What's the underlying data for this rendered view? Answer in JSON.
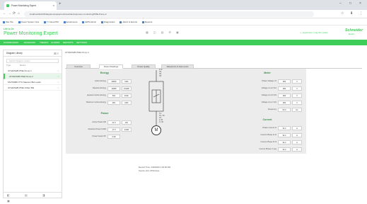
{
  "browser": {
    "tab_title": "Power Monitoring Expert",
    "tab_close": "×",
    "new_tab": "+",
    "window_controls": [
      "–",
      "□",
      "×"
    ],
    "nav": [
      "←",
      "→",
      "⟳",
      "⌂"
    ],
    "url": "localhost/Web/#/diagrams/equipment/view/device/power-monitoring/PME-Pump-2",
    "addr_icons": [
      "☆",
      "⬇",
      "⋮"
    ],
    "bookmarks": [
      "Site Tile",
      "Power System Ops",
      "Tr Cloud PM",
      "Ecostruxure",
      "EMS Admin",
      "Diagnostics",
      "Alarm & Events",
      "Reports"
    ]
  },
  "app": {
    "brand_small": "Life Is On",
    "title": "Power Monitoring Expert",
    "header_icons": [
      "▦",
      "◫",
      "▤",
      "⚙",
      "▣"
    ],
    "header_right": "☺ supervisor | Log Out | Help",
    "logo": "Schneider",
    "logo_sub": "Electric",
    "menu": [
      "DASHBOARDS",
      "DIAGRAMS",
      "TRENDS",
      "ALARMS",
      "REPORTS",
      "SETTINGS"
    ]
  },
  "sidebar": {
    "title": "Diagram Library",
    "icons": "⊞ ≡",
    "search_placeholder": "Search Diagram Library",
    "filters": [
      "Type",
      "Device"
    ],
    "items": [
      {
        "label": "ATS/ESWB PME Pump 1",
        "selected": false
      },
      {
        "label": "ATS/ESWB PME Pump 2",
        "selected": true
      },
      {
        "label": "MV/SWBD PTS Stations Bld Loads",
        "selected": false
      },
      {
        "label": "ATS/ESWB PME Chiller Bld",
        "selected": false
      }
    ],
    "footer_icons": "◧ ▤ ◨ ▣"
  },
  "main": {
    "breadcrumb": "ATS/ESWB PME Pump 2",
    "tabs": [
      "Overview",
      "Power Readings",
      "Power Quality",
      "Waveforms & Harmonics"
    ],
    "energy": {
      "title": "Energy",
      "fields": [
        {
          "label": "Active Energy",
          "value": "43846",
          "unit": "kWh"
        },
        {
          "label": "Reactive Energy",
          "value": "14835",
          "unit": "kVARh"
        },
        {
          "label": "Apparent Active Energy",
          "value": "502",
          "unit": "kVAh"
        },
        {
          "label": "Maximum Active Energy",
          "value": "381",
          "unit": "kWh"
        }
      ]
    },
    "power": {
      "title": "Power",
      "fields": [
        {
          "label": "Active Power kW",
          "value": "21.5",
          "unit": "kW"
        },
        {
          "label": "Reactive Power kVAR",
          "value": "17.5",
          "unit": "kVAR"
        },
        {
          "label": "Power Factor PF",
          "value": "0.98",
          "unit": ""
        }
      ]
    },
    "meter": {
      "title": "Meter",
      "fields": [
        {
          "label": "Phase Voltage V1",
          "value": "480",
          "unit": "V"
        },
        {
          "label": "Voltage L1-L2 V12",
          "value": "480",
          "unit": "V"
        },
        {
          "label": "Voltage L2-L3 V23",
          "value": "480",
          "unit": "V"
        },
        {
          "label": "Voltage L3-L1 V31",
          "value": "480",
          "unit": "V"
        },
        {
          "label": "Frequency",
          "value": "60.0",
          "unit": "Hz"
        }
      ]
    },
    "current": {
      "title": "Current",
      "fields": [
        {
          "label": "Phase Current I1",
          "value": "32.2",
          "unit": "A"
        },
        {
          "label": "Current Phase I2 I2",
          "value": "32.2",
          "unit": "A"
        },
        {
          "label": "Current Phase I3 I3",
          "value": "32.2",
          "unit": "A"
        },
        {
          "label": "Current Phase I I avg",
          "value": "32.2",
          "unit": "A"
        }
      ]
    },
    "diagram": {
      "top_labels": [
        "G P",
        "X1",
        "X2",
        "X3"
      ],
      "bottom_labels": [
        "T1",
        "T2, T3",
        "T4",
        "A, B",
        "C, W"
      ],
      "motor_label": "M"
    },
    "footer": {
      "record_time": "Record Time: 2/18/2023 1:20:36 PM",
      "source": "Source Unit: ATS/Amps"
    }
  }
}
